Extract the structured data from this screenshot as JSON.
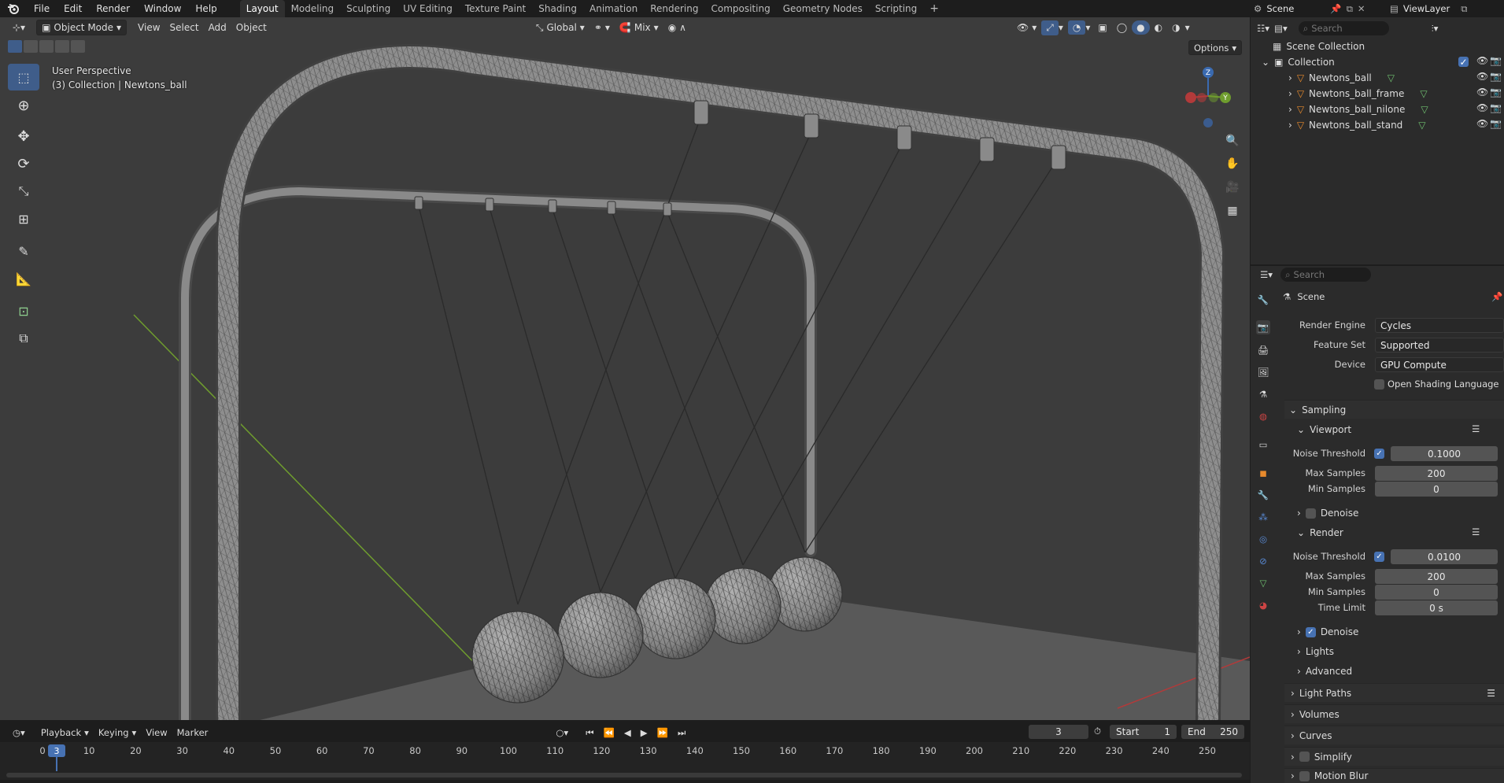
{
  "menus": [
    "File",
    "Edit",
    "Render",
    "Window",
    "Help"
  ],
  "workspaces": [
    "Layout",
    "Modeling",
    "Sculpting",
    "UV Editing",
    "Texture Paint",
    "Shading",
    "Animation",
    "Rendering",
    "Compositing",
    "Geometry Nodes",
    "Scripting"
  ],
  "active_workspace": "Layout",
  "scene_name": "Scene",
  "viewlayer_name": "ViewLayer",
  "viewport_header": {
    "mode": "Object Mode",
    "menus": [
      "View",
      "Select",
      "Add",
      "Object"
    ],
    "orientation": "Global",
    "snap_mode": "Mix",
    "options": "Options"
  },
  "overlay": {
    "perspective": "User Perspective",
    "collection_info": "(3) Collection | Newtons_ball"
  },
  "outliner": {
    "search_placeholder": "Search",
    "root": "Scene Collection",
    "collection": "Collection",
    "objects": [
      "Newtons_ball",
      "Newtons_ball_frame",
      "Newtons_ball_nilone",
      "Newtons_ball_stand"
    ]
  },
  "properties": {
    "search_placeholder": "Search",
    "context": "Scene",
    "render_engine_label": "Render Engine",
    "render_engine": "Cycles",
    "feature_set_label": "Feature Set",
    "feature_set": "Supported",
    "device_label": "Device",
    "device": "GPU Compute",
    "osl_label": "Open Shading Language",
    "sampling": "Sampling",
    "viewport": "Viewport",
    "noise_threshold_label": "Noise Threshold",
    "vp_noise_threshold": "0.1000",
    "max_samples_label": "Max Samples",
    "vp_max_samples": "200",
    "min_samples_label": "Min Samples",
    "vp_min_samples": "0",
    "denoise_label": "Denoise",
    "render": "Render",
    "r_noise_threshold": "0.0100",
    "r_max_samples": "200",
    "r_min_samples": "0",
    "time_limit_label": "Time Limit",
    "r_time_limit": "0 s",
    "lights": "Lights",
    "advanced": "Advanced",
    "light_paths": "Light Paths",
    "volumes": "Volumes",
    "curves": "Curves",
    "simplify": "Simplify",
    "motion_blur": "Motion Blur"
  },
  "timeline": {
    "menus": [
      "Playback",
      "Keying",
      "View",
      "Marker"
    ],
    "current_frame": "3",
    "start_label": "Start",
    "start": "1",
    "end_label": "End",
    "end": "250",
    "ticks": [
      "0",
      "10",
      "20",
      "30",
      "40",
      "50",
      "60",
      "70",
      "80",
      "90",
      "100",
      "110",
      "120",
      "130",
      "140",
      "150",
      "160",
      "170",
      "180",
      "190",
      "200",
      "210",
      "220",
      "230",
      "240",
      "250"
    ]
  },
  "colors": {
    "accent": "#4772b3",
    "viewport_bg": "#3c3c3c",
    "panel_bg": "#2b2b2b",
    "header_bg": "#1d1d1d",
    "y_axis": "#6f9d2e",
    "x_axis": "#b23a3a"
  }
}
